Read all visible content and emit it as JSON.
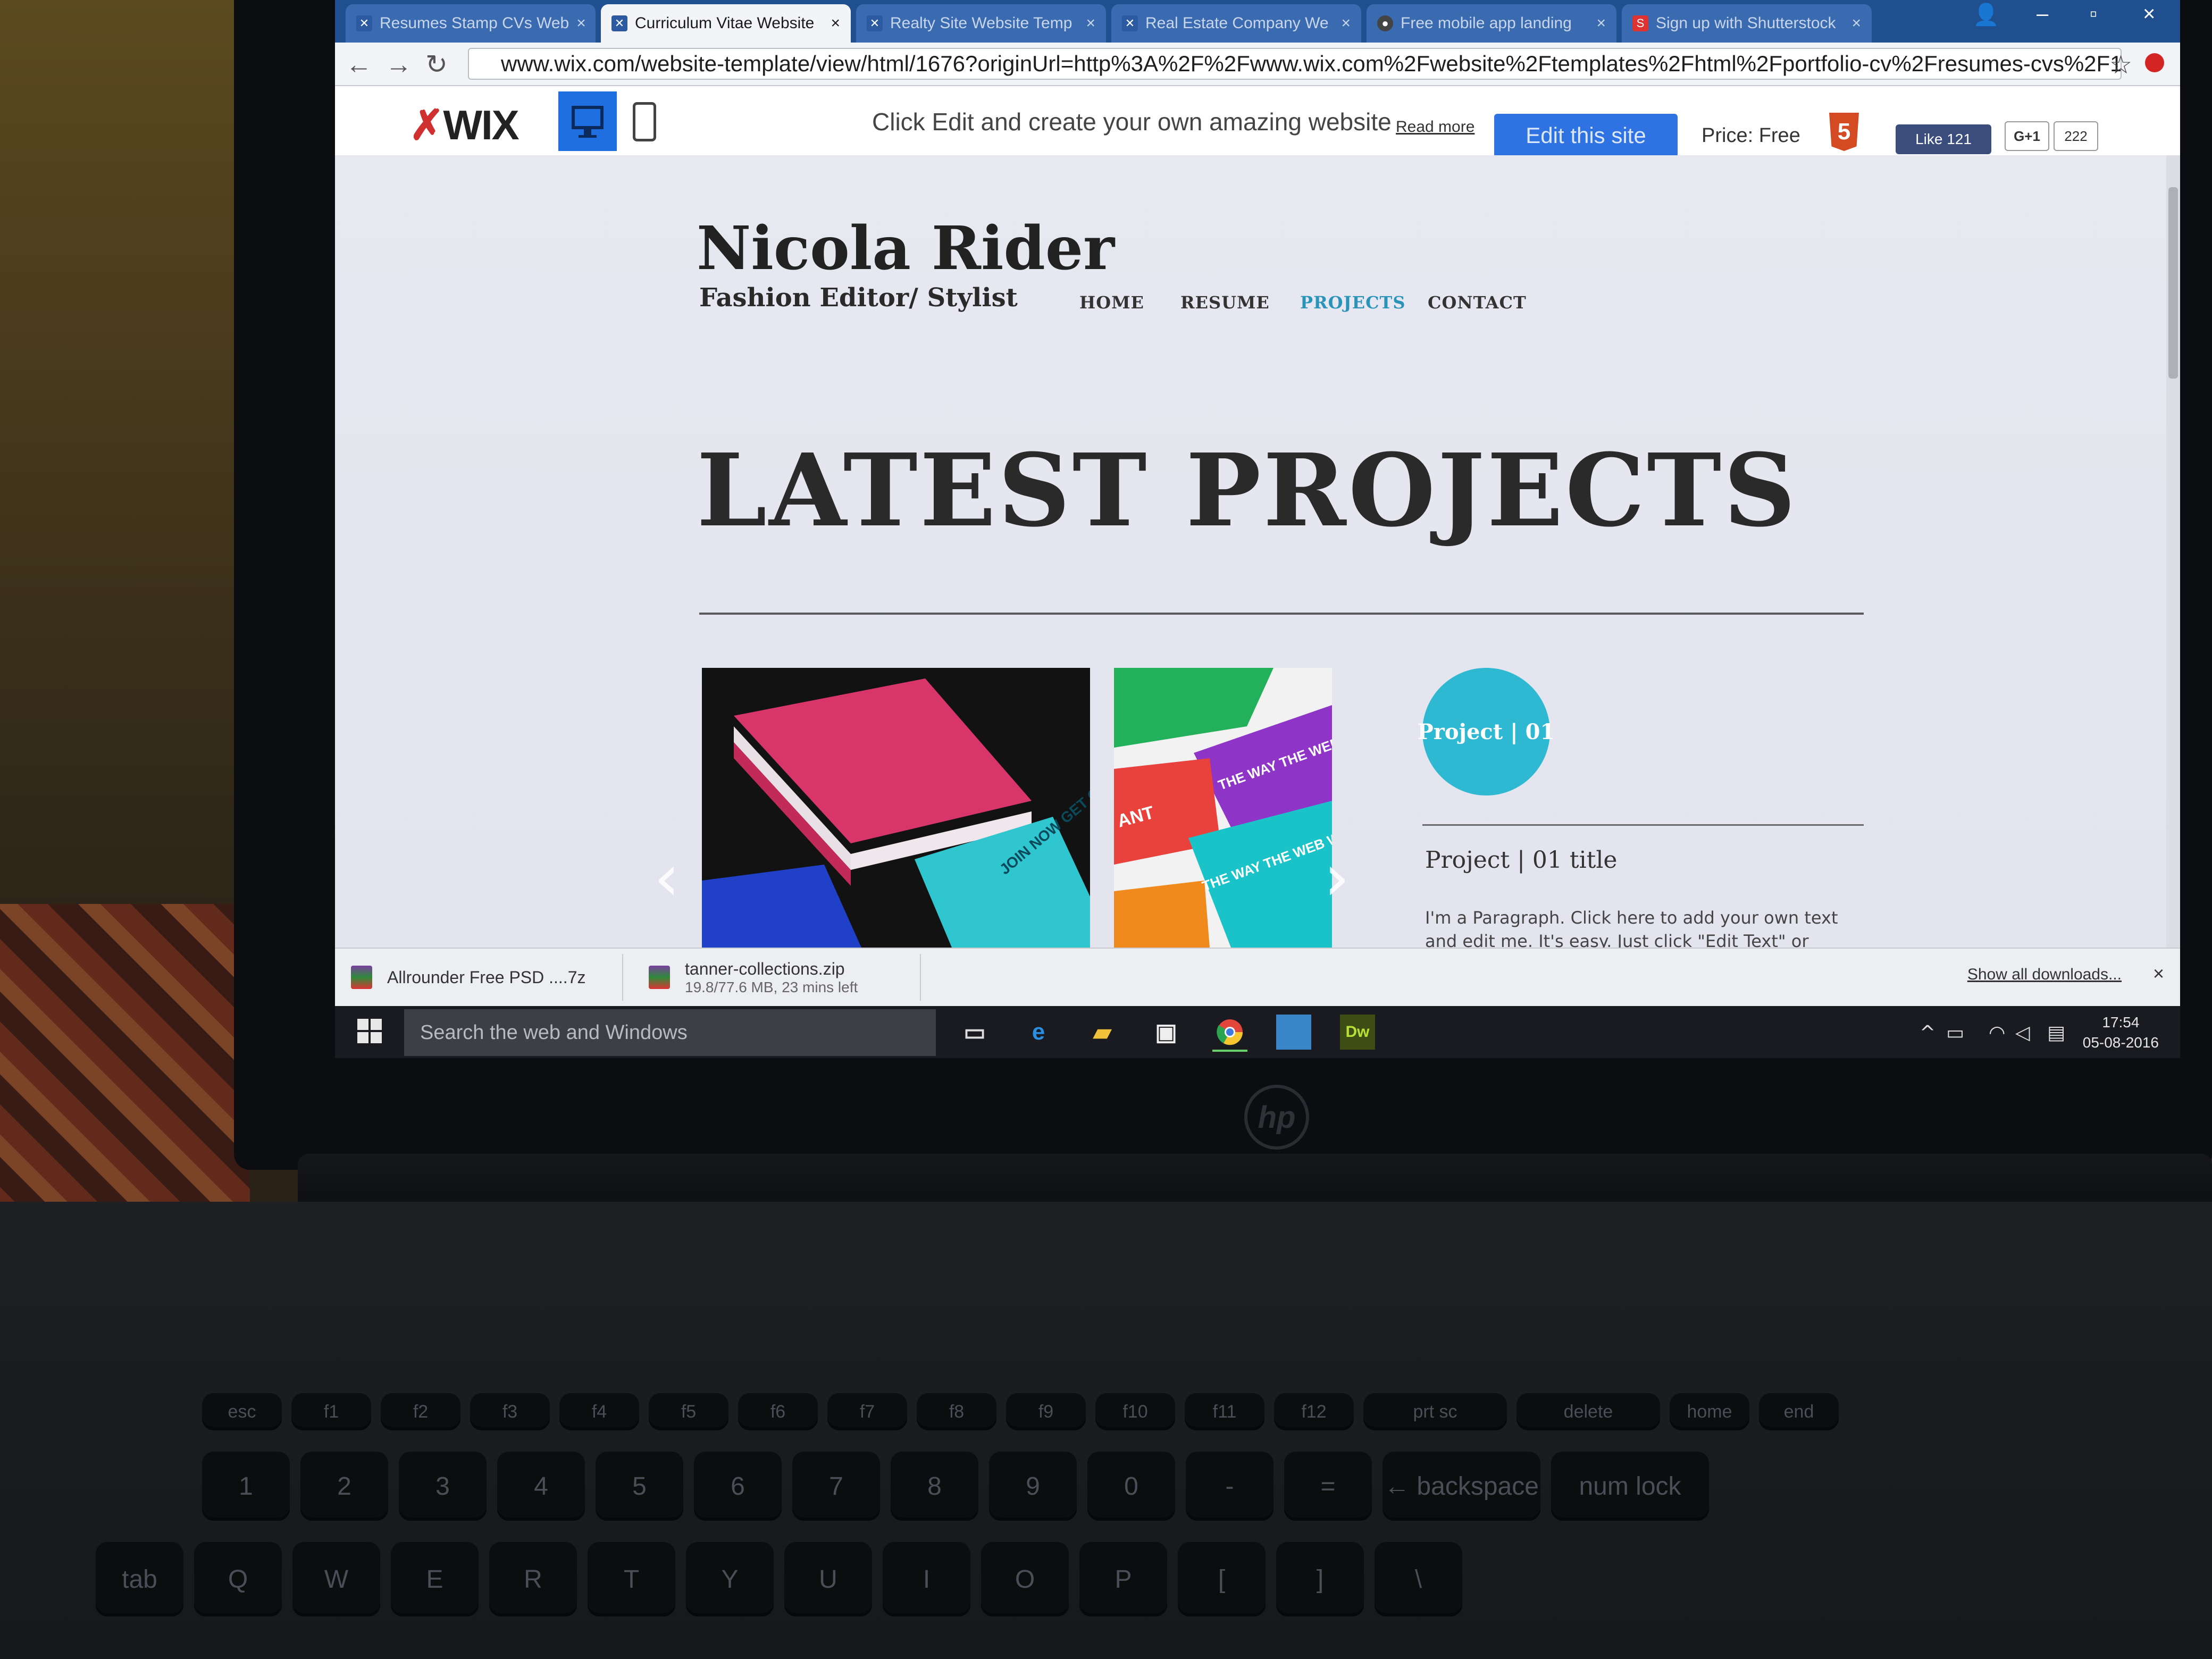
{
  "browser": {
    "tabs": [
      {
        "label": "Resumes Stamp CVs Web",
        "active": false
      },
      {
        "label": "Curriculum Vitae Website",
        "active": true
      },
      {
        "label": "Realty Site Website Temp",
        "active": false
      },
      {
        "label": "Real Estate Company We",
        "active": false
      },
      {
        "label": "Free mobile app landing",
        "active": false
      },
      {
        "label": "Sign up with Shutterstock",
        "active": false
      }
    ],
    "url": "www.wix.com/website-template/view/html/1676?originUrl=http%3A%2F%2Fwww.wix.com%2Fwebsite%2Ftemplates%2Fhtml%2Fportfolio-cv%2Fresumes-cvs%2F1&"
  },
  "wix_bar": {
    "logo": "WIX",
    "promo_text": "Click Edit and create your own amazing website",
    "read_more": "Read more",
    "edit_button": "Edit this site",
    "price": "Price: Free",
    "html5_badge": "5",
    "fb_like": "Like 121",
    "gplus": "G+1",
    "gplus_count": "222"
  },
  "site": {
    "name": "Nicola Rider",
    "subtitle": "Fashion Editor/ Stylist",
    "menu": [
      {
        "label": "HOME",
        "active": false
      },
      {
        "label": "RESUME",
        "active": false
      },
      {
        "label": "PROJECTS",
        "active": true
      },
      {
        "label": "CONTACT",
        "active": false
      }
    ],
    "heading": "LATEST PROJECTS",
    "project_badge": "Project | 01",
    "project_title": "Project | 01 title",
    "project_paragraph": "I'm a Paragraph. Click here to add your own text and edit me. It's easy. Just click \"Edit Text\" or double click",
    "slide_texts": [
      "JOIN NOW GET CREATIVE",
      "THE WAY THE WEB WAS MEANT TO BE",
      "ANT",
      "THE WAY THE WEB WAS MEANT TO BE"
    ]
  },
  "downloads": {
    "items": [
      {
        "name": "Allrounder Free PSD ....7z",
        "status": ""
      },
      {
        "name": "tanner-collections.zip",
        "status": "19.8/77.6 MB, 23 mins left"
      }
    ],
    "show_all": "Show all downloads..."
  },
  "taskbar": {
    "search_placeholder": "Search the web and Windows",
    "time": "17:54",
    "date": "05-08-2016"
  },
  "keyboard": {
    "fn_row": [
      "esc",
      "f1",
      "f2",
      "f3",
      "f4",
      "f5",
      "f6",
      "f7",
      "f8",
      "f9",
      "f10",
      "f11",
      "f12",
      "prt sc",
      "delete",
      "home",
      "end"
    ],
    "number_row": [
      "1",
      "2",
      "3",
      "4",
      "5",
      "6",
      "7",
      "8",
      "9",
      "0",
      "-",
      "=",
      "← backspace",
      "num lock"
    ],
    "letter_row": [
      "tab",
      "Q",
      "W",
      "E",
      "R",
      "T",
      "Y",
      "U",
      "I",
      "O",
      "P",
      "[",
      "]",
      "\\"
    ]
  },
  "colors": {
    "accent_teal": "#2fb8d2",
    "wix_blue": "#2f73e2",
    "active_menu": "#2a94b8"
  }
}
